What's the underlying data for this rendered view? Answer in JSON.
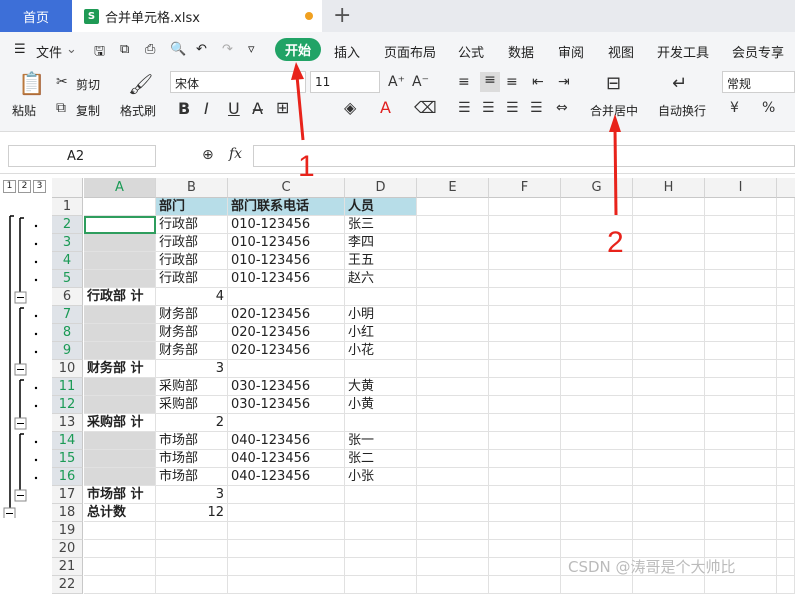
{
  "tabs": {
    "home": "首页",
    "file": "合并单元格.xlsx",
    "new_tab": "+"
  },
  "menu": {
    "file": "文件",
    "items": [
      "开始",
      "插入",
      "页面布局",
      "公式",
      "数据",
      "审阅",
      "视图",
      "开发工具",
      "会员专享"
    ]
  },
  "ribbon": {
    "paste": "粘贴",
    "cut": "剪切",
    "copy": "复制",
    "format_painter": "格式刷",
    "font_name": "宋体",
    "font_size": "11",
    "merge_center": "合并居中",
    "wrap_text": "自动换行",
    "number_format": "常规",
    "currency": "¥",
    "percent": "%"
  },
  "formula_bar": {
    "name_box": "A2",
    "fx": "fx",
    "value": ""
  },
  "outline_levels": [
    "1",
    "2",
    "3"
  ],
  "columns": [
    "A",
    "B",
    "C",
    "D",
    "E",
    "F",
    "G",
    "H",
    "I"
  ],
  "rows": [
    {
      "n": "1",
      "a": "",
      "b": "部门",
      "c": "部门联系电话",
      "d": "人员",
      "header": true
    },
    {
      "n": "2",
      "a": "",
      "b": "行政部",
      "c": "010-123456",
      "d": "张三",
      "sel": true
    },
    {
      "n": "3",
      "a": "",
      "b": "行政部",
      "c": "010-123456",
      "d": "李四",
      "sel": true
    },
    {
      "n": "4",
      "a": "",
      "b": "行政部",
      "c": "010-123456",
      "d": "王五",
      "sel": true
    },
    {
      "n": "5",
      "a": "",
      "b": "行政部",
      "c": "010-123456",
      "d": "赵六",
      "sel": true
    },
    {
      "n": "6",
      "a": "行政部 计",
      "b": "4",
      "c": "",
      "d": "",
      "bold": true
    },
    {
      "n": "7",
      "a": "",
      "b": "财务部",
      "c": "020-123456",
      "d": "小明",
      "sel": true
    },
    {
      "n": "8",
      "a": "",
      "b": "财务部",
      "c": "020-123456",
      "d": "小红",
      "sel": true
    },
    {
      "n": "9",
      "a": "",
      "b": "财务部",
      "c": "020-123456",
      "d": "小花",
      "sel": true
    },
    {
      "n": "10",
      "a": "财务部 计",
      "b": "3",
      "c": "",
      "d": "",
      "bold": true
    },
    {
      "n": "11",
      "a": "",
      "b": "采购部",
      "c": "030-123456",
      "d": "大黄",
      "sel": true
    },
    {
      "n": "12",
      "a": "",
      "b": "采购部",
      "c": "030-123456",
      "d": "小黄",
      "sel": true
    },
    {
      "n": "13",
      "a": "采购部 计",
      "b": "2",
      "c": "",
      "d": "",
      "bold": true
    },
    {
      "n": "14",
      "a": "",
      "b": "市场部",
      "c": "040-123456",
      "d": "张一",
      "sel": true
    },
    {
      "n": "15",
      "a": "",
      "b": "市场部",
      "c": "040-123456",
      "d": "张二",
      "sel": true
    },
    {
      "n": "16",
      "a": "",
      "b": "市场部",
      "c": "040-123456",
      "d": "小张",
      "sel": true
    },
    {
      "n": "17",
      "a": "市场部 计",
      "b": "3",
      "c": "",
      "d": "",
      "bold": true
    },
    {
      "n": "18",
      "a": "总计数",
      "b": "12",
      "c": "",
      "d": "",
      "bold": true
    },
    {
      "n": "19",
      "a": "",
      "b": "",
      "c": "",
      "d": ""
    },
    {
      "n": "20",
      "a": "",
      "b": "",
      "c": "",
      "d": ""
    },
    {
      "n": "21",
      "a": "",
      "b": "",
      "c": "",
      "d": ""
    },
    {
      "n": "22",
      "a": "",
      "b": "",
      "c": "",
      "d": ""
    }
  ],
  "annotations": {
    "one": "1",
    "two": "2"
  },
  "watermark": "CSDN @涛哥是个大帅比",
  "colors": {
    "accent": "#21a366",
    "tab_blue": "#3d6fd8",
    "arrow": "#e8231b",
    "header_fill": "#b7dde8"
  }
}
